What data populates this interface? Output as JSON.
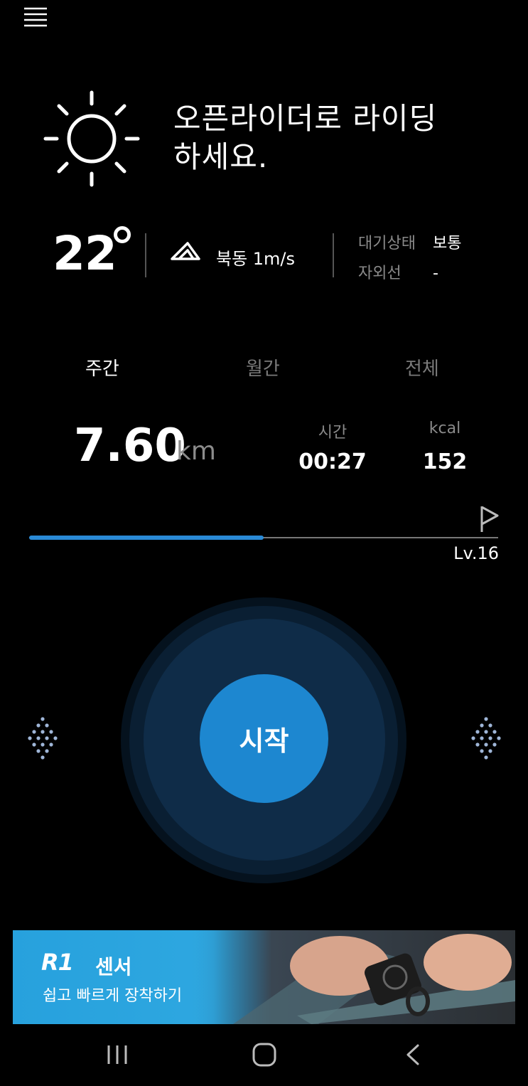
{
  "header": {
    "menu_icon": "hamburger-menu-icon"
  },
  "weather": {
    "icon": "sun-icon",
    "headline_line1": "오픈라이더로 라이딩",
    "headline_line2": "하세요.",
    "temperature": "22",
    "wind_icon": "wind-direction-icon",
    "wind": "북동 1m/s",
    "air_quality_label": "대기상태",
    "air_quality_value": "보통",
    "uv_label": "자외선",
    "uv_value": "-"
  },
  "period_tabs": [
    {
      "label": "주간",
      "active": true
    },
    {
      "label": "월간",
      "active": false
    },
    {
      "label": "전체",
      "active": false
    }
  ],
  "stats": {
    "distance": "7.60",
    "distance_unit": "km",
    "time_label": "시간",
    "time_value": "00:27",
    "kcal_label": "kcal",
    "kcal_value": "152"
  },
  "level": {
    "label": "Lv.16",
    "progress": 0.5,
    "accent": "#2a8ad6",
    "flag_icon": "flag-icon"
  },
  "start": {
    "label": "시작",
    "color": "#1d87d0"
  },
  "nav_arrows": {
    "left": "chevron-left-dotted-icon",
    "right": "chevron-right-dotted-icon"
  },
  "banner": {
    "logo": "R1",
    "title": "센서",
    "subtitle": "쉽고 빠르게 장착하기"
  },
  "system_nav": {
    "recent": "recent-apps-icon",
    "home": "home-icon",
    "back": "back-icon"
  }
}
